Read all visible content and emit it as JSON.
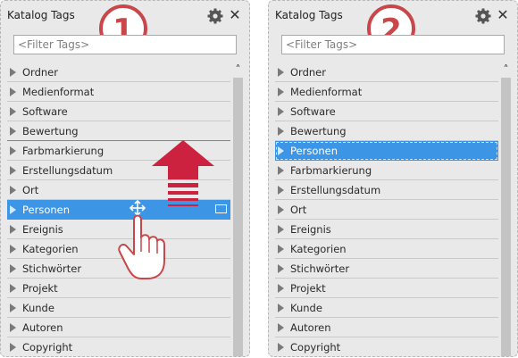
{
  "panels": [
    {
      "step": "1",
      "title": "Katalog Tags",
      "filter_placeholder": "<Filter Tags>",
      "items": [
        "Ordner",
        "Medienformat",
        "Software",
        "Bewertung",
        "Farbmarkierung",
        "Erstellungsdatum",
        "Ort",
        "Personen",
        "Ereignis",
        "Kategorien",
        "Stichwörter",
        "Projekt",
        "Kunde",
        "Autoren",
        "Copyright"
      ],
      "selected": "Personen"
    },
    {
      "step": "2",
      "title": "Katalog Tags",
      "filter_placeholder": "<Filter Tags>",
      "items": [
        "Ordner",
        "Medienformat",
        "Software",
        "Bewertung",
        "Personen",
        "Farbmarkierung",
        "Erstellungsdatum",
        "Ort",
        "Ereignis",
        "Kategorien",
        "Stichwörter",
        "Projekt",
        "Kunde",
        "Autoren",
        "Copyright"
      ],
      "selected": "Personen"
    }
  ],
  "colors": {
    "panel_bg": "#e9e9e9",
    "selection": "#3d95e6",
    "badge": "#c8474a",
    "arrow": "#cc2240"
  },
  "icons": [
    "gear-icon",
    "close-icon",
    "expand-triangle-icon",
    "scroll-up-icon",
    "move-cursor-icon",
    "hand-pointer-icon",
    "up-arrow-icon"
  ]
}
